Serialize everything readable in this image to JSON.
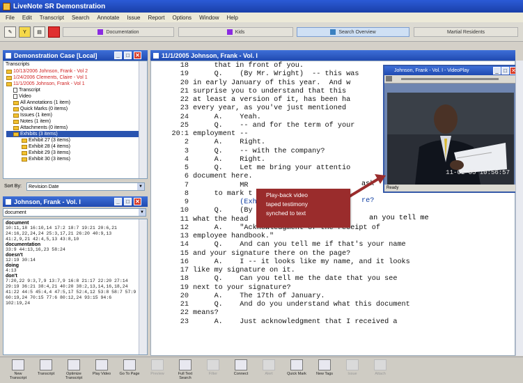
{
  "app": {
    "title": "LiveNote SR Demonstration"
  },
  "menu": [
    "File",
    "Edit",
    "Transcript",
    "Search",
    "Annotate",
    "Issue",
    "Report",
    "Options",
    "Window",
    "Help"
  ],
  "toolbar": {
    "icons": [
      "open-icon",
      "yellow-icon",
      "save-icon"
    ],
    "tabs": [
      {
        "label": "Documentation",
        "color": "#8a2be2"
      },
      {
        "label": "Kids",
        "color": "#8a2be2"
      },
      {
        "label": "Search Overview",
        "color": "#3a80c0"
      },
      {
        "label": "Martial Residents",
        "color": ""
      }
    ]
  },
  "case_panel": {
    "title": "Demonstration Case [Local]",
    "section_label": "Transcripts",
    "items": [
      {
        "text": "10/13/2006  Johnson, Frank - Vol 2",
        "style": "red",
        "icon": "folder"
      },
      {
        "text": "1/24/2006  Clements, Claire - Vol 1",
        "style": "red",
        "icon": "folder"
      },
      {
        "text": "11/1/2005  Johnson, Frank - Vol 1",
        "style": "red",
        "icon": "folder"
      },
      {
        "text": "Transcript",
        "style": "",
        "icon": "doc"
      },
      {
        "text": "Video",
        "style": "",
        "icon": "doc"
      },
      {
        "text": "All Annotations (1 item)",
        "style": "",
        "icon": "folder"
      },
      {
        "text": "Quick Marks (0 items)",
        "style": "",
        "icon": "folder"
      },
      {
        "text": "Issues (1 item)",
        "style": "",
        "icon": "folder"
      },
      {
        "text": "Notes (1 item)",
        "style": "",
        "icon": "folder"
      },
      {
        "text": "Attachments (0 items)",
        "style": "",
        "icon": "folder"
      },
      {
        "text": "Exhibits (3 items)",
        "style": "sel",
        "icon": "folder"
      },
      {
        "text": "Exhibit 27 (3 items)",
        "style": "",
        "icon": "folder"
      },
      {
        "text": "Exhibit 28 (4 items)",
        "style": "",
        "icon": "folder"
      },
      {
        "text": "Exhibit 29 (3 items)",
        "style": "",
        "icon": "folder"
      },
      {
        "text": "Exhibit 30 (3 items)",
        "style": "",
        "icon": "folder"
      }
    ],
    "sort_label": "Sort By:",
    "sort_value": "Revision Date"
  },
  "index_panel": {
    "title": "Johnson, Frank - Vol. I",
    "filter_value": "document",
    "entries": [
      {
        "word": "document",
        "refs": "10:11,18 16:10,14 17:2 18:7 19:21 20:6,21 24:16,22,24,24 25:3,17,21 26:20 40:9,13 41:2,9,21 42:4,5,13 43:8,10"
      },
      {
        "word": "documentation",
        "refs": "33:9 44:13,16,23 58:24"
      },
      {
        "word": "doesn't",
        "refs": "12:19 30:14"
      },
      {
        "word": "doing",
        "refs": "4:13"
      },
      {
        "word": "don't",
        "refs": "7:20,22 9:3,7,9 13:7,9 16:8 21:17 22:20 27:14 29:19 36:21 38:4,21 40:20 38:2,13,14,16,18,24 41:22 44:5 45:4,4 47:5,17 52:4,12 53:8 58:7 57:9 60:19,24 70:15 77:6 80:12,24 93:15 94:6 102:19,24"
      }
    ]
  },
  "transcript": {
    "title": "11/1/2005 Johnson, Frank - Vol. I",
    "lines": [
      {
        "num": "18",
        "text": "     that in front of you.",
        "link": false
      },
      {
        "num": "19",
        "text": "     Q.    (By Mr. Wright)  -- this was",
        "link": false
      },
      {
        "num": "20",
        "text": "in early January of this year.  And w",
        "link": false
      },
      {
        "num": "21",
        "text": "surprise you to understand that this",
        "link": false
      },
      {
        "num": "22",
        "text": "at least a version of it, has been ha",
        "link": false
      },
      {
        "num": "23",
        "text": "every year, as you've just mentioned",
        "link": false
      },
      {
        "num": "24",
        "text": "     A.    Yeah.",
        "link": false
      },
      {
        "num": "25",
        "text": "     Q.    -- and for the term of your",
        "link": false
      },
      {
        "num": "20:1",
        "text": "employment --",
        "link": false
      },
      {
        "num": "2",
        "text": "     A.    Right.",
        "link": false
      },
      {
        "num": "3",
        "text": "     Q.    -- with the company?",
        "link": false
      },
      {
        "num": "4",
        "text": "     A.    Right.",
        "link": false
      },
      {
        "num": "5",
        "text": "     Q.    Let me bring your attentio",
        "link": false
      },
      {
        "num": "6",
        "text": "document here.",
        "link": false
      },
      {
        "num": "7",
        "text": "           MR",
        "link": false
      },
      {
        "num": "8",
        "text": "     to mark t",
        "link": false
      },
      {
        "num": "9",
        "text": "           (Exh",
        "link": true
      },
      {
        "num": "10",
        "text": "     Q.    (By",
        "link": false
      },
      {
        "num": "11",
        "text": "what the head",
        "link": false
      },
      {
        "num": "12",
        "text": "     A.    \"Acknowledgment of the receipt of",
        "link": false
      },
      {
        "num": "13",
        "text": "employee handbook.\"",
        "link": false
      },
      {
        "num": "14",
        "text": "     Q.    And can you tell me if that's your name",
        "link": false
      },
      {
        "num": "15",
        "text": "and your signature there on the page?",
        "link": false
      },
      {
        "num": "16",
        "text": "     A.    I -- it looks like my name, and it looks",
        "link": false
      },
      {
        "num": "17",
        "text": "like my signature on it.",
        "link": false
      },
      {
        "num": "18",
        "text": "     Q.    Can you tell me the date that you see",
        "link": false
      },
      {
        "num": "19",
        "text": "next to your signature?",
        "link": false
      },
      {
        "num": "20",
        "text": "     A.    The 17th of January.",
        "link": false
      },
      {
        "num": "21",
        "text": "     Q.    And do you understand what this document",
        "link": false
      },
      {
        "num": "22",
        "text": "means?",
        "link": false
      },
      {
        "num": "23",
        "text": "     A.    Just acknowledgment that I received a",
        "link": false
      }
    ],
    "fragments": {
      "ask": "ask",
      "re": "re?",
      "tell": "an you tell me"
    }
  },
  "video": {
    "title": "Johnson, Frank - Vol. I - VideoPlay",
    "timestamp": "11-01-05 10:56:57",
    "status": "Ready"
  },
  "callout": {
    "lines": [
      "Play-back video",
      "taped testimony",
      "synched to text"
    ],
    "color": "#9a2c2c"
  },
  "bottom_toolbar": [
    {
      "label": "New\nTranscript",
      "icon": "new-transcript-icon",
      "dim": false
    },
    {
      "label": "Transcript",
      "icon": "transcript-icon",
      "dim": false
    },
    {
      "label": "Optimize\nTranscript",
      "icon": "optimize-icon",
      "dim": false
    },
    {
      "label": "Play Video",
      "icon": "play-video-icon",
      "dim": false
    },
    {
      "label": "Go To Page",
      "icon": "go-to-page-icon",
      "dim": false
    },
    {
      "label": "Preview",
      "icon": "preview-icon",
      "dim": true
    },
    {
      "label": "Full Text\nSearch",
      "icon": "search-icon",
      "dim": false
    },
    {
      "label": "Filter",
      "icon": "filter-icon",
      "dim": true
    },
    {
      "label": "Connect",
      "icon": "connect-icon",
      "dim": false
    },
    {
      "label": "Alert",
      "icon": "alert-icon",
      "dim": true
    },
    {
      "label": "Quick Mark",
      "icon": "quick-mark-icon",
      "dim": false
    },
    {
      "label": "New Tags",
      "icon": "new-tags-icon",
      "dim": false
    },
    {
      "label": "Issue",
      "icon": "issue-icon",
      "dim": true
    },
    {
      "label": "Attach",
      "icon": "attach-icon",
      "dim": true
    }
  ]
}
